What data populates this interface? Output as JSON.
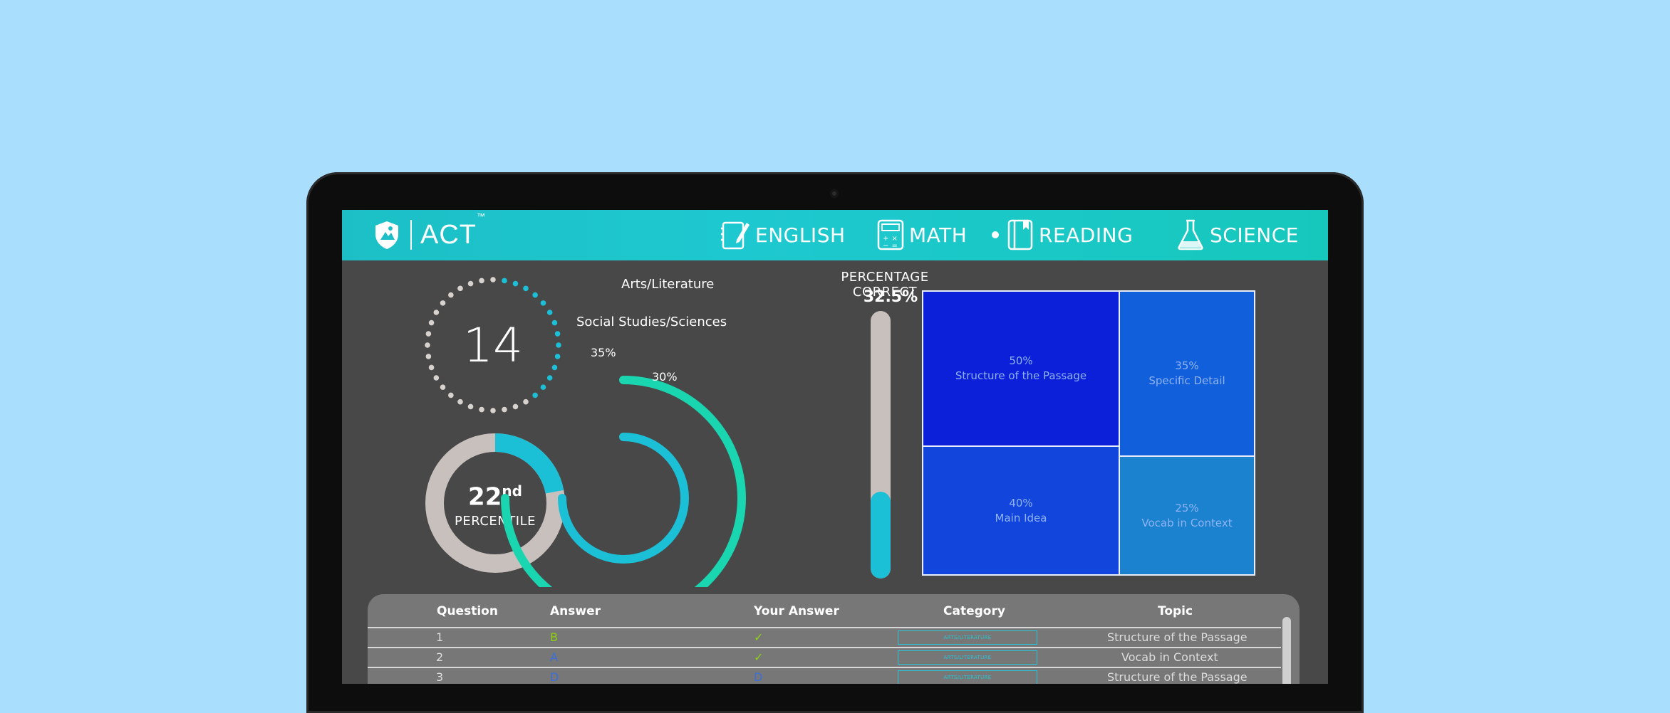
{
  "brand": {
    "name": "ACT",
    "tm": "™"
  },
  "nav": [
    {
      "label": "ENGLISH",
      "icon": "pencil-notebook-icon",
      "active": false
    },
    {
      "label": "MATH",
      "icon": "calculator-icon",
      "active": false
    },
    {
      "label": "READING",
      "icon": "book-icon",
      "active": true
    },
    {
      "label": "SCIENCE",
      "icon": "flask-icon",
      "active": false
    }
  ],
  "score": {
    "value": "14"
  },
  "percentile": {
    "rank": "22",
    "suffix": "nd",
    "label": "PERCENTILE",
    "fraction": 0.22
  },
  "categories": {
    "outer": {
      "label": "Arts/Literature",
      "percent_text": "35%",
      "value": 0.75
    },
    "inner": {
      "label": "Social Studies/Sciences",
      "percent_text": "30%",
      "value": 0.75
    }
  },
  "percentage_correct": {
    "title": "PERCENTAGE CORRECT",
    "value_text": "32.5%",
    "value": 0.325
  },
  "topics": [
    {
      "percent": "50%",
      "name": "Structure of the Passage",
      "color": "#0d20d9"
    },
    {
      "percent": "35%",
      "name": "Specific Detail",
      "color": "#125fdb"
    },
    {
      "percent": "40%",
      "name": "Main Idea",
      "color": "#1145dc"
    },
    {
      "percent": "25%",
      "name": "Vocab in Context",
      "color": "#1a82cf"
    }
  ],
  "table": {
    "headers": {
      "question": "Question",
      "answer": "Answer",
      "your_answer": "Your Answer",
      "category": "Category",
      "topic": "Topic"
    },
    "rows": [
      {
        "question": "1",
        "answer": "B",
        "answer_color": "#8ed10e",
        "your": "✓",
        "your_color": "#8ed10e",
        "category": "ARTS/LITERATURE",
        "topic": "Structure of the Passage"
      },
      {
        "question": "2",
        "answer": "A",
        "answer_color": "#3a6fd8",
        "your": "✓",
        "your_color": "#8ed10e",
        "category": "ARTS/LITERATURE",
        "topic": "Vocab in Context"
      },
      {
        "question": "3",
        "answer": "D",
        "answer_color": "#3a6fd8",
        "your": "D",
        "your_color": "#3a6fd8",
        "category": "ARTS/LITERATURE",
        "topic": "Structure of the Passage"
      }
    ]
  },
  "colors": {
    "accent": "#1bbfd6",
    "teal": "#19d6b0",
    "panel": "#484848",
    "track": "#c8c0bd"
  }
}
